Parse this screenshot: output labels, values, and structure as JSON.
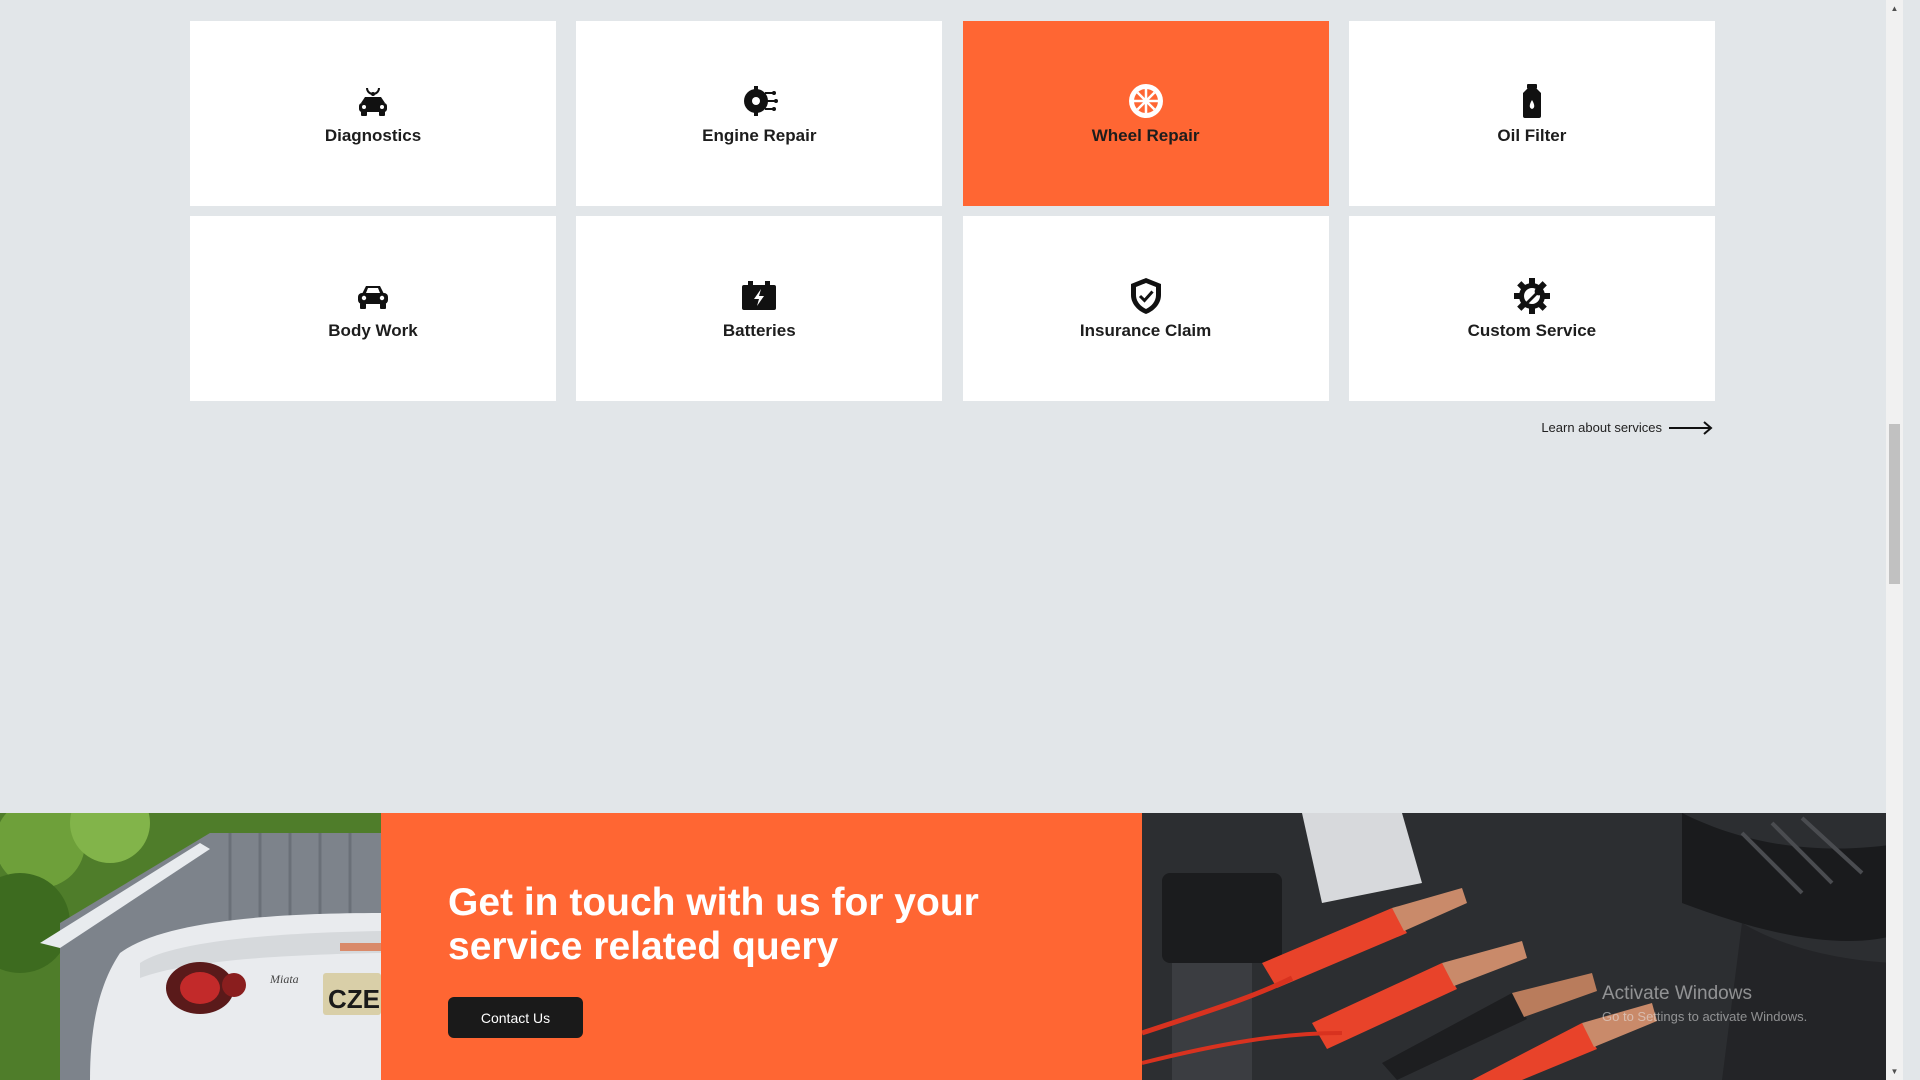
{
  "services": [
    {
      "label": "Diagnostics",
      "icon": "car-diagnostics-icon",
      "active": false
    },
    {
      "label": "Engine Repair",
      "icon": "engine-icon",
      "active": false
    },
    {
      "label": "Wheel Repair",
      "icon": "wheel-icon",
      "active": true
    },
    {
      "label": "Oil Filter",
      "icon": "oil-can-icon",
      "active": false
    },
    {
      "label": "Body Work",
      "icon": "car-icon",
      "active": false
    },
    {
      "label": "Batteries",
      "icon": "battery-icon",
      "active": false
    },
    {
      "label": "Insurance Claim",
      "icon": "shield-check-icon",
      "active": false
    },
    {
      "label": "Custom Service",
      "icon": "gear-wrench-icon",
      "active": false
    }
  ],
  "learn_link": {
    "label": "Learn about services",
    "icon": "long-arrow-right-icon"
  },
  "cta": {
    "heading": "Get in touch with us for your service related query",
    "button_label": "Contact Us"
  },
  "watermark": {
    "title": "Activate Windows",
    "subtitle": "Go to Settings to activate Windows."
  },
  "colors": {
    "accent": "#ff6633",
    "background": "#e2e6e9",
    "card": "#ffffff",
    "button": "#1a1a1a"
  }
}
